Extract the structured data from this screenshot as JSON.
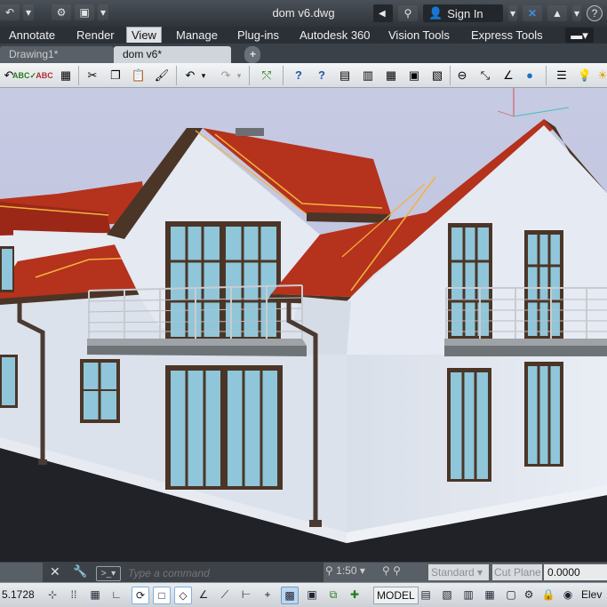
{
  "titlebar": {
    "document_title": "dom v6.dwg",
    "sign_in_label": "Sign In",
    "quick_access": [
      "undo-icon",
      "dropdown-icon",
      "workspace-icon",
      "dropdown-icon"
    ],
    "right_icons": [
      "binoculars-icon",
      "user-icon",
      "exchange-x-icon",
      "autodesk-icon",
      "help-icon"
    ]
  },
  "ribbon": {
    "tabs": [
      {
        "label": "Annotate"
      },
      {
        "label": "Render"
      },
      {
        "label": "View",
        "active": true
      },
      {
        "label": "Manage"
      },
      {
        "label": "Plug-ins"
      },
      {
        "label": "Autodesk 360"
      },
      {
        "label": "Vision Tools"
      },
      {
        "label": "Express Tools"
      }
    ],
    "options_icon": "ribbon-options-icon"
  },
  "doc_tabs": [
    {
      "label": "Drawing1*",
      "active": false
    },
    {
      "label": "dom v6*",
      "active": true
    }
  ],
  "toolbar": {
    "icons": [
      "spellcheck-icon",
      "find-replace-icon",
      "calculator-icon",
      "cut-icon",
      "copy-icon",
      "paste-icon",
      "match-properties-icon",
      "undo-icon",
      "redo-icon",
      "pan-realtime-icon",
      "help-icon",
      "help-icon",
      "table-icon",
      "design-center-icon",
      "tool-palettes-icon",
      "sheet-set-icon",
      "markup-icon",
      "distance-icon",
      "area-icon",
      "angle-icon",
      "render-sphere-icon",
      "layer-icon",
      "light-bulb-icon"
    ]
  },
  "command_line": {
    "placeholder": "Type a command",
    "annotation_scale": "1:50",
    "text_style": "Standard",
    "cut_plane": "Cut Plane",
    "elevation_value": "0.0000"
  },
  "status_bar": {
    "coordinate": "5.1728",
    "model_label": "MODEL",
    "elevation_label": "Elev"
  },
  "colors": {
    "roof": "#b5321c",
    "roof_trim": "#f2b33d",
    "wall": "#e4e9f2",
    "window_glass": "#8fc6da",
    "window_frame": "#4b3527",
    "sky": "#c4c7e0",
    "ground": "#222328"
  }
}
